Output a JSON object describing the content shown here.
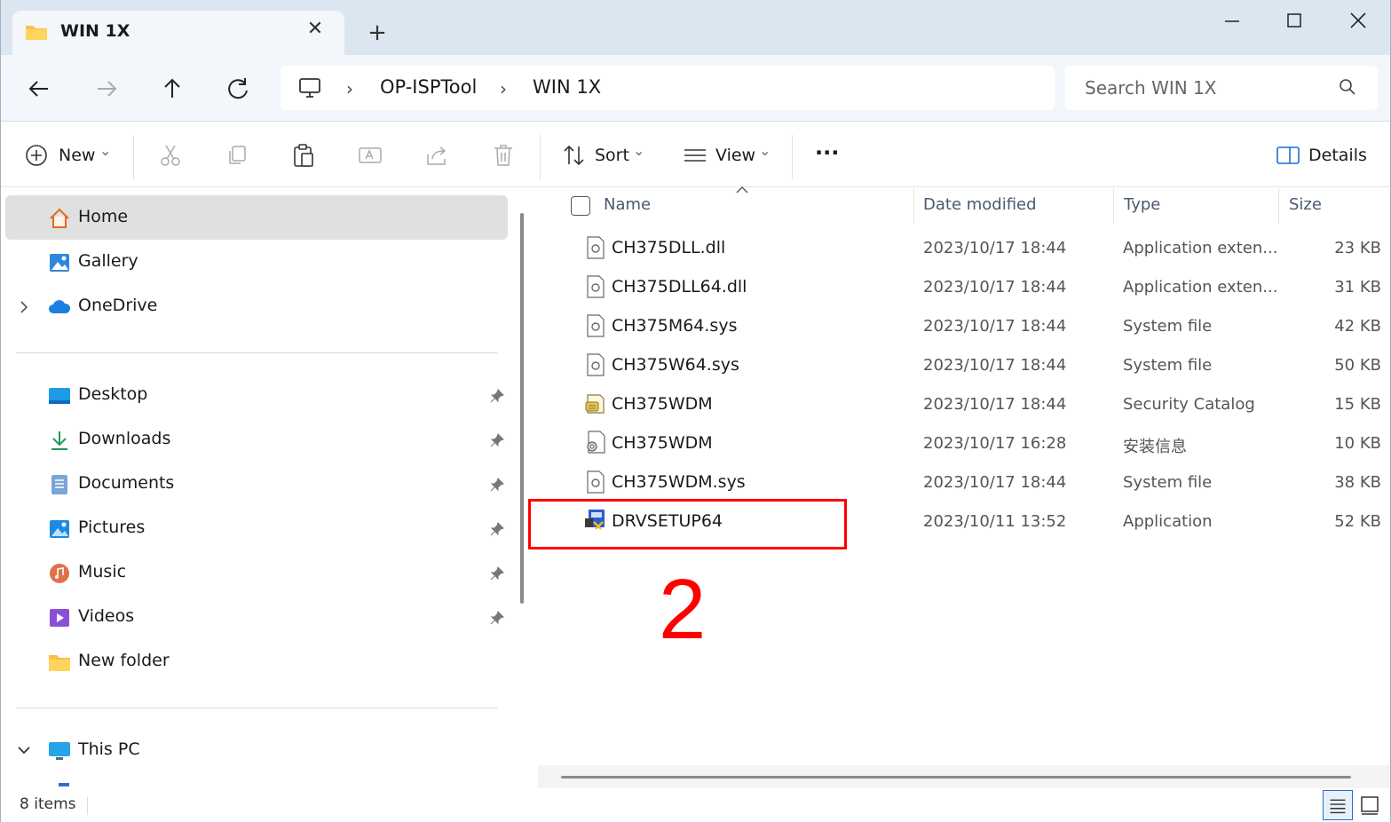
{
  "window": {
    "tab_title": "WIN 1X",
    "tab_close": "✕",
    "new_tab": "+"
  },
  "address": {
    "crumbs": [
      "OP-ISPTool",
      "WIN 1X"
    ],
    "separator": "›",
    "search_placeholder": "Search WIN 1X"
  },
  "toolbar": {
    "new_label": "New",
    "sort_label": "Sort",
    "view_label": "View",
    "more_label": "···",
    "details_label": "Details",
    "chevron": "⌄"
  },
  "sidebar": {
    "quick": [
      {
        "label": "Home",
        "icon": "home-icon",
        "selected": true
      },
      {
        "label": "Gallery",
        "icon": "gallery-icon"
      },
      {
        "label": "OneDrive",
        "icon": "onedrive-icon",
        "expandable": true
      }
    ],
    "pinned": [
      {
        "label": "Desktop",
        "icon": "desktop-folder-icon",
        "pinned": true
      },
      {
        "label": "Downloads",
        "icon": "downloads-icon",
        "pinned": true
      },
      {
        "label": "Documents",
        "icon": "documents-icon",
        "pinned": true
      },
      {
        "label": "Pictures",
        "icon": "pictures-icon",
        "pinned": true
      },
      {
        "label": "Music",
        "icon": "music-icon",
        "pinned": true
      },
      {
        "label": "Videos",
        "icon": "videos-icon",
        "pinned": true
      },
      {
        "label": "New folder",
        "icon": "folder-icon",
        "pinned": false
      }
    ],
    "this_pc": "This PC"
  },
  "columns": {
    "name": "Name",
    "date": "Date modified",
    "type": "Type",
    "size": "Size"
  },
  "files": [
    {
      "name": "CH375DLL.dll",
      "date": "2023/10/17 18:44",
      "type": "Application exten...",
      "size": "23 KB",
      "icon": "dll-file-icon"
    },
    {
      "name": "CH375DLL64.dll",
      "date": "2023/10/17 18:44",
      "type": "Application exten...",
      "size": "31 KB",
      "icon": "dll-file-icon"
    },
    {
      "name": "CH375M64.sys",
      "date": "2023/10/17 18:44",
      "type": "System file",
      "size": "42 KB",
      "icon": "sys-file-icon"
    },
    {
      "name": "CH375W64.sys",
      "date": "2023/10/17 18:44",
      "type": "System file",
      "size": "50 KB",
      "icon": "sys-file-icon"
    },
    {
      "name": "CH375WDM",
      "date": "2023/10/17 18:44",
      "type": "Security Catalog",
      "size": "15 KB",
      "icon": "catalog-file-icon"
    },
    {
      "name": "CH375WDM",
      "date": "2023/10/17 16:28",
      "type": "安装信息",
      "size": "10 KB",
      "icon": "inf-file-icon"
    },
    {
      "name": "CH375WDM.sys",
      "date": "2023/10/17 18:44",
      "type": "System file",
      "size": "38 KB",
      "icon": "sys-file-icon"
    },
    {
      "name": "DRVSETUP64",
      "date": "2023/10/11 13:52",
      "type": "Application",
      "size": "52 KB",
      "icon": "setup-exe-icon"
    }
  ],
  "annotation": {
    "number": "2",
    "color": "#ff0000"
  },
  "status": {
    "items": "8 items"
  },
  "colors": {
    "accent": "#2a70c9",
    "titlebar": "#dce6f0",
    "selected": "#e0e0e0"
  }
}
